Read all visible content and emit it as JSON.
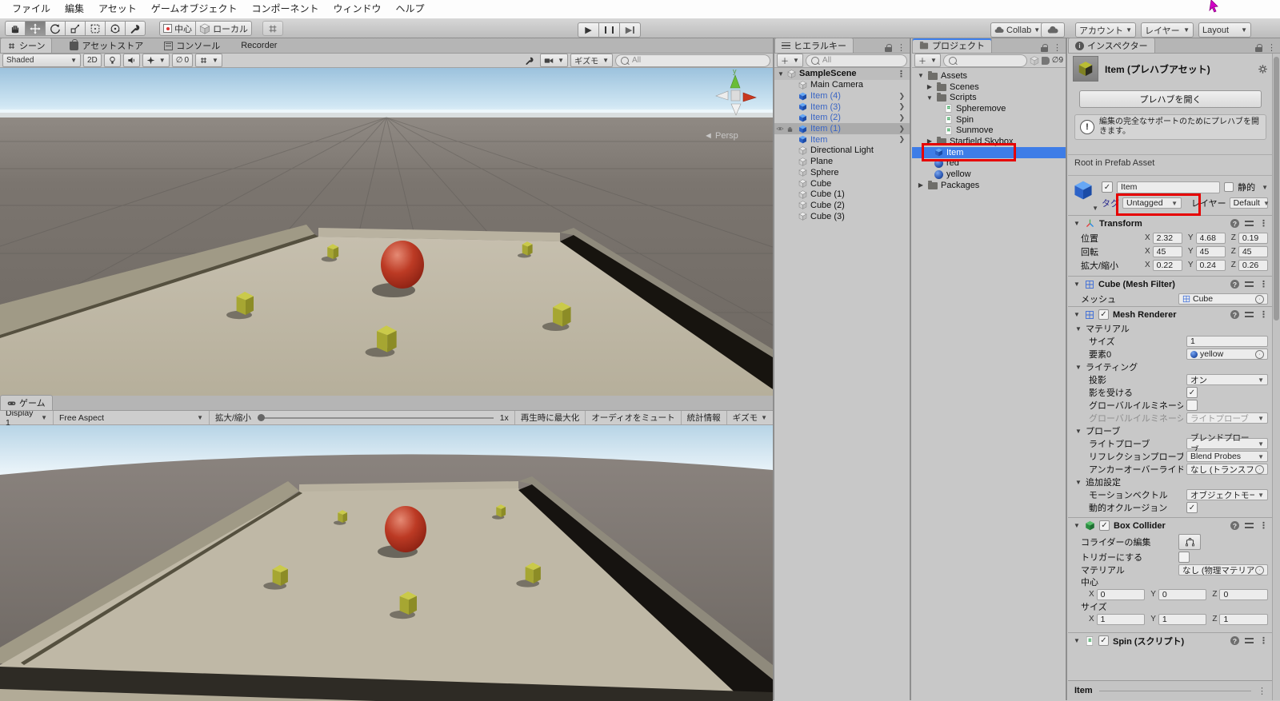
{
  "menu_bar": {
    "items": [
      "ファイル",
      "編集",
      "アセット",
      "ゲームオブジェクト",
      "コンポーネント",
      "ウィンドウ",
      "ヘルプ"
    ]
  },
  "toolbar": {
    "pivot_label": "中心",
    "space_label": "ローカル",
    "collab_label": "Collab",
    "account_label": "アカウント",
    "layers_label": "レイヤー",
    "layout_label": "Layout"
  },
  "scene_panel": {
    "tabs": [
      "シーン",
      "アセットストア",
      "コンソール",
      "Recorder"
    ],
    "shading": "Shaded",
    "mode_2d": "2D",
    "hidden_count": "0",
    "gizmos_label": "ギズモ",
    "search_placeholder": "All",
    "persp_label": "Persp"
  },
  "game_panel": {
    "tab": "ゲーム",
    "display": "Display 1",
    "aspect": "Free Aspect",
    "scale_label": "拡大/縮小",
    "scale_value": "1x",
    "maximize_label": "再生時に最大化",
    "mute_label": "オーディオをミュート",
    "stats_label": "統計情報",
    "gizmos_label": "ギズモ"
  },
  "hierarchy": {
    "tab": "ヒエラルキー",
    "search_placeholder": "All",
    "scene_name": "SampleScene",
    "items": [
      {
        "label": "Main Camera"
      },
      {
        "label": "Item (4)"
      },
      {
        "label": "Item (3)"
      },
      {
        "label": "Item (2)"
      },
      {
        "label": "Item (1)"
      },
      {
        "label": "Item"
      },
      {
        "label": "Directional Light"
      },
      {
        "label": "Plane"
      },
      {
        "label": "Sphere"
      },
      {
        "label": "Cube"
      },
      {
        "label": "Cube (1)"
      },
      {
        "label": "Cube (2)"
      },
      {
        "label": "Cube (3)"
      }
    ]
  },
  "project": {
    "tab": "プロジェクト",
    "hidden_count": "9",
    "tree": [
      {
        "label": "Assets"
      },
      {
        "label": "Scenes"
      },
      {
        "label": "Scripts"
      },
      {
        "label": "Spheremove"
      },
      {
        "label": "Spin"
      },
      {
        "label": "Sunmove"
      },
      {
        "label": "Starfield Skybox"
      },
      {
        "label": "Item"
      },
      {
        "label": "red"
      },
      {
        "label": "yellow"
      },
      {
        "label": "Packages"
      }
    ]
  },
  "inspector": {
    "tab": "インスペクター",
    "title": "Item (プレハブアセット)",
    "open_prefab": "プレハブを開く",
    "info": "編集の完全なサポートのためにプレハブを開きます。",
    "root_label": "Root in Prefab Asset",
    "name_value": "Item",
    "static_label": "静的",
    "tag_label": "タグ",
    "tag_value": "Untagged",
    "layer_label": "レイヤー",
    "layer_value": "Default",
    "axis": {
      "x": "X",
      "y": "Y",
      "z": "Z"
    },
    "transform": {
      "title": "Transform",
      "rows": [
        {
          "label": "位置",
          "x": "2.32",
          "y": "4.68",
          "z": "0.19"
        },
        {
          "label": "回転",
          "x": "45",
          "y": "45",
          "z": "45"
        },
        {
          "label": "拡大/縮小",
          "x": "0.22",
          "y": "0.24",
          "z": "0.26"
        }
      ]
    },
    "mesh_filter": {
      "title": "Cube (Mesh Filter)",
      "mesh_label": "メッシュ",
      "mesh_value": "Cube"
    },
    "mesh_renderer": {
      "title": "Mesh Renderer",
      "materials_label": "マテリアル",
      "size_label": "サイズ",
      "size_value": "1",
      "element_label": "要素0",
      "element_value": "yellow",
      "lighting_label": "ライティング",
      "cast_label": "投影",
      "cast_value": "オン",
      "receive_label": "影を受ける",
      "gi_label": "グローバルイルミネーシ:",
      "gi_mode_label": "グローバルイルミネーシ:",
      "gi_mode_value": "ライトプローブ",
      "probes_label": "プローブ",
      "light_probe_label": "ライトプローブ",
      "light_probe_value": "ブレンドプローブ",
      "reflection_label": "リフレクションプローブ",
      "reflection_value": "Blend Probes",
      "anchor_label": "アンカーオーバーライド",
      "anchor_value": "なし (トランスフォーム)",
      "additional_label": "追加設定",
      "motion_label": "モーションベクトル",
      "motion_value": "オブジェクトモーション",
      "occlusion_label": "動的オクルージョン"
    },
    "box_collider": {
      "title": "Box Collider",
      "edit_label": "コライダーの編集",
      "trigger_label": "トリガーにする",
      "material_label": "マテリアル",
      "material_value": "なし (物理マテリアル)",
      "center_label": "中心",
      "center_x": "0",
      "center_y": "0",
      "center_z": "0",
      "size_label": "サイズ",
      "size_x": "1",
      "size_y": "1",
      "size_z": "1"
    },
    "spin_title": "Spin (スクリプト)",
    "preview_label": "Item"
  }
}
